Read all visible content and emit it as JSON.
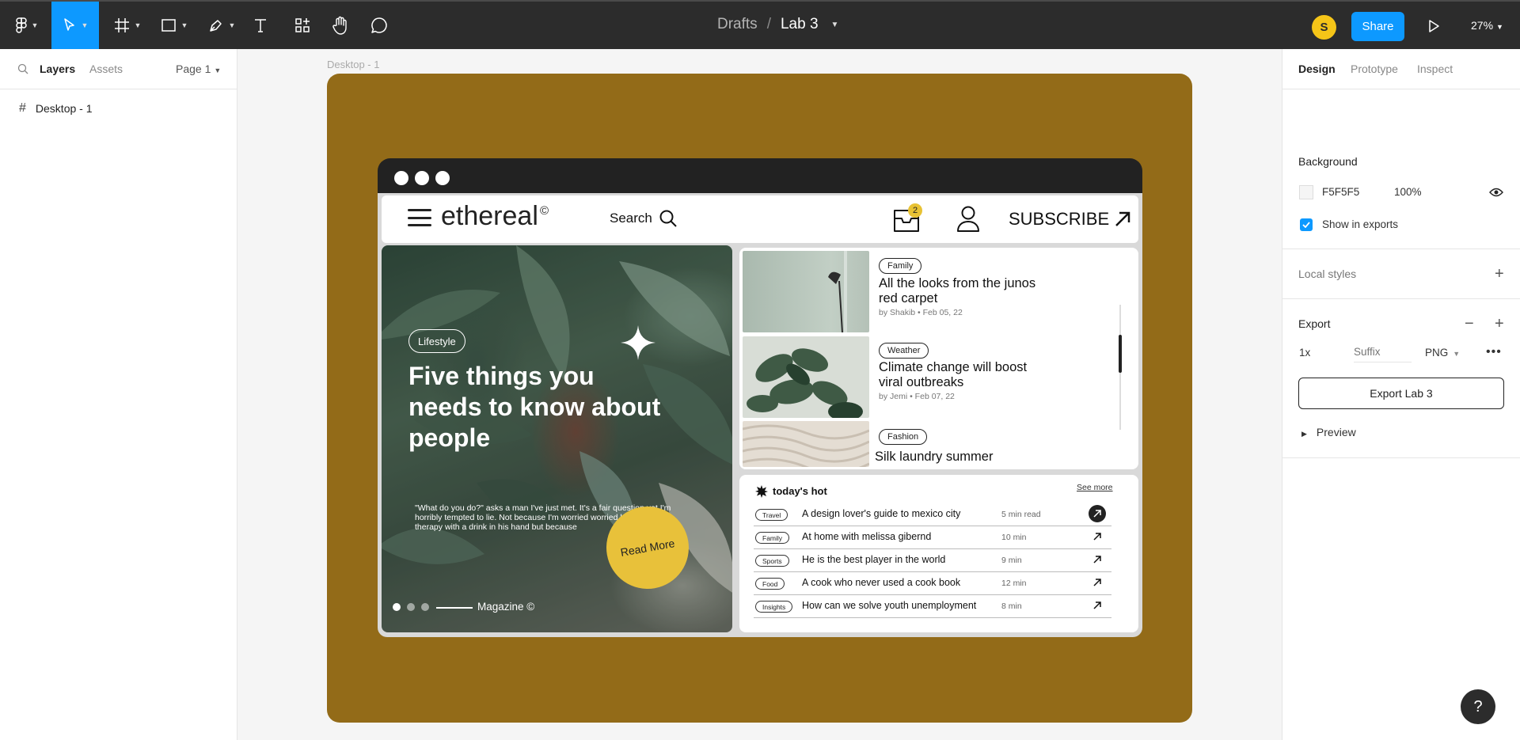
{
  "toolbar": {
    "breadcrumb_parent": "Drafts",
    "breadcrumb_sep": "/",
    "file_name": "Lab 3",
    "avatar_initial": "S",
    "share_label": "Share",
    "zoom": "27%"
  },
  "left_panel": {
    "tabs": [
      "Layers",
      "Assets"
    ],
    "page": "Page 1",
    "layers": [
      "Desktop - 1"
    ]
  },
  "canvas": {
    "frame_label": "Desktop - 1",
    "frame_color": "#936B18"
  },
  "site": {
    "logo": "ethereal",
    "logo_mark": "©",
    "search_label": "Search",
    "mail_badge": "2",
    "subscribe": "SUBSCRIBE",
    "hero": {
      "tag": "Lifestyle",
      "title": "Five things you needs to know about people",
      "quote": "\"What do you do?\" asks a man I've just met. It's a fair question yet I'm horribly tempted to lie. Not because I'm worried worried he'll want free therapy with a drink in his hand but because",
      "read_more": "Read More",
      "magazine": "Magazine ©"
    },
    "articles": [
      {
        "tag": "Family",
        "title": "All the looks from the junos red carpet",
        "meta": "by Shakib • Feb 05, 22"
      },
      {
        "tag": "Weather",
        "title": "Climate change will boost viral outbreaks",
        "meta": "by Jemi • Feb 07, 22"
      },
      {
        "tag": "Fashion",
        "title": "Silk laundry summer",
        "meta": ""
      }
    ],
    "hot": {
      "title": "today's hot",
      "see_more": "See more",
      "items": [
        {
          "tag": "Travel",
          "text": "A design lover's guide to mexico city",
          "time": "5 min read"
        },
        {
          "tag": "Family",
          "text": "At home with melissa gibernd",
          "time": "10 min"
        },
        {
          "tag": "Sports",
          "text": "He is the best player in the world",
          "time": "9 min"
        },
        {
          "tag": "Food",
          "text": "A cook who never used a cook book",
          "time": "12 min"
        },
        {
          "tag": "Insights",
          "text": "How can we solve youth unemployment",
          "time": "8 min"
        }
      ]
    }
  },
  "right_panel": {
    "tabs": [
      "Design",
      "Prototype",
      "Inspect"
    ],
    "background_title": "Background",
    "bg_hex": "F5F5F5",
    "bg_opacity": "100%",
    "show_in_exports": "Show in exports",
    "local_styles": "Local styles",
    "export_title": "Export",
    "export_scale": "1x",
    "suffix_placeholder": "Suffix",
    "export_format": "PNG",
    "export_button": "Export Lab 3",
    "preview": "Preview"
  },
  "help_label": "?",
  "colors": {
    "accent": "#0D99FF",
    "toolbar_bg": "#2C2C2C",
    "read_more": "#E8C13A"
  }
}
